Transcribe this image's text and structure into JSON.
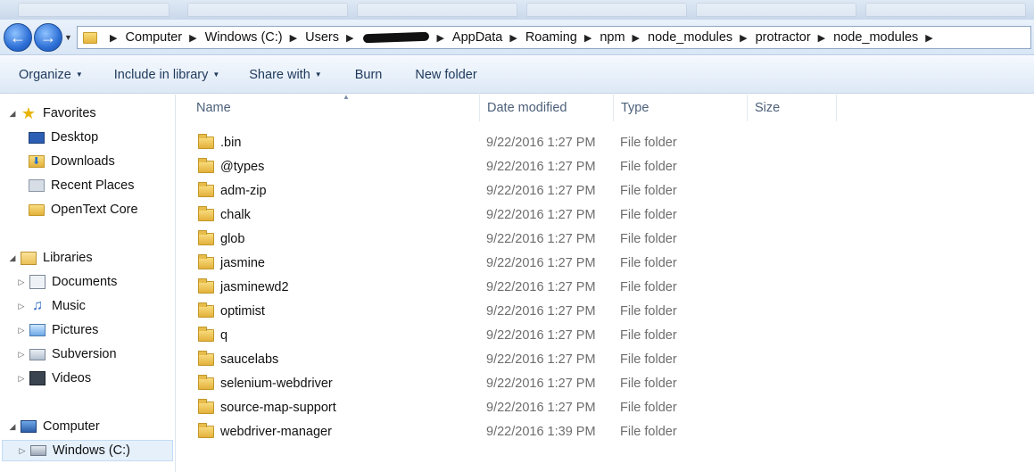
{
  "address_bar": {
    "breadcrumbs": [
      "Computer",
      "Windows (C:)",
      "Users",
      "AppData",
      "Roaming",
      "npm",
      "node_modules",
      "protractor",
      "node_modules"
    ]
  },
  "toolbar": {
    "organize": "Organize",
    "include_in_library": "Include in library",
    "share_with": "Share with",
    "burn": "Burn",
    "new_folder": "New folder"
  },
  "navigation": {
    "favorites_label": "Favorites",
    "favorites": [
      "Desktop",
      "Downloads",
      "Recent Places",
      "OpenText Core"
    ],
    "libraries_label": "Libraries",
    "libraries": [
      "Documents",
      "Music",
      "Pictures",
      "Subversion",
      "Videos"
    ],
    "computer_label": "Computer",
    "computer": [
      "Windows (C:)"
    ]
  },
  "columns": {
    "name": "Name",
    "date_modified": "Date modified",
    "type": "Type",
    "size": "Size"
  },
  "files": [
    {
      "name": ".bin",
      "date": "9/22/2016 1:27 PM",
      "type": "File folder"
    },
    {
      "name": "@types",
      "date": "9/22/2016 1:27 PM",
      "type": "File folder"
    },
    {
      "name": "adm-zip",
      "date": "9/22/2016 1:27 PM",
      "type": "File folder"
    },
    {
      "name": "chalk",
      "date": "9/22/2016 1:27 PM",
      "type": "File folder"
    },
    {
      "name": "glob",
      "date": "9/22/2016 1:27 PM",
      "type": "File folder"
    },
    {
      "name": "jasmine",
      "date": "9/22/2016 1:27 PM",
      "type": "File folder"
    },
    {
      "name": "jasminewd2",
      "date": "9/22/2016 1:27 PM",
      "type": "File folder"
    },
    {
      "name": "optimist",
      "date": "9/22/2016 1:27 PM",
      "type": "File folder"
    },
    {
      "name": "q",
      "date": "9/22/2016 1:27 PM",
      "type": "File folder"
    },
    {
      "name": "saucelabs",
      "date": "9/22/2016 1:27 PM",
      "type": "File folder"
    },
    {
      "name": "selenium-webdriver",
      "date": "9/22/2016 1:27 PM",
      "type": "File folder"
    },
    {
      "name": "source-map-support",
      "date": "9/22/2016 1:27 PM",
      "type": "File folder"
    },
    {
      "name": "webdriver-manager",
      "date": "9/22/2016 1:39 PM",
      "type": "File folder"
    }
  ]
}
